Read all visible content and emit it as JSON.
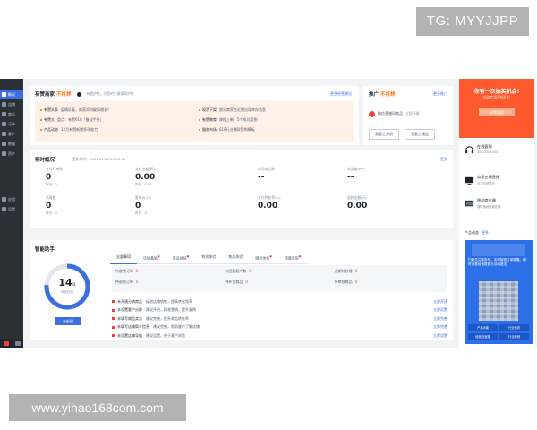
{
  "watermarks": {
    "top": "TG: MYYJJPP",
    "bottom": "www.yihao168com.com"
  },
  "nav": {
    "items": [
      "概况",
      "店铺",
      "商品",
      "订单",
      "客户",
      "数据",
      "资产"
    ],
    "lower_items": [
      "应用",
      "设置"
    ]
  },
  "notice": {
    "title": "有赞商家",
    "title_em": "不打烊",
    "tag": "有赞护航，为您的生意保驾护航",
    "link": "更多经营建议",
    "lines": [
      {
        "k": "有赞头条",
        "v": "疫情反复，商家如何破局增长？"
      },
      {
        "k": "现货下架",
        "v": "部分商家在近期出现库存告急"
      },
      {
        "k": "有赞大",
        "v": "盘点：有赞618「备战手册」"
      },
      {
        "k": "有赞教育",
        "v": "课程上新：5个成功案例"
      },
      {
        "k": "产品动态",
        "v": "12月有赞新增多项能力"
      },
      {
        "k": "服务市场",
        "v": "618行业爆款营销模板"
      }
    ]
  },
  "promo": {
    "title": "推广",
    "title_em": "不打烊",
    "link": "更多推广",
    "row_name": "微信直播间商品",
    "row_state": "立即开通",
    "btn1": "我要上分销",
    "btn2": "我要上爆品"
  },
  "realtime": {
    "title": "实时概况",
    "updated": "更新时间：2021-01-24 23:59:49",
    "link": "更多",
    "stats": [
      {
        "lbl": "支付订单数",
        "val": "0",
        "sub": "昨日：0"
      },
      {
        "lbl": "支付金额(元)",
        "val": "0.00",
        "sub": "昨日：0.00"
      },
      {
        "lbl": "访问商品数",
        "val": "--",
        "sub": ""
      },
      {
        "lbl": "浏览量(PV)",
        "val": "--",
        "sub": ""
      },
      {
        "lbl": "访客数",
        "val": "0",
        "sub": "昨日：0"
      },
      {
        "lbl": "客单价(元)",
        "val": "0",
        "sub": "昨日：0"
      },
      {
        "lbl": "支付转化率(%)",
        "val": "0.00",
        "sub": ""
      },
      {
        "lbl": "退款金额(元)",
        "val": "0.00",
        "sub": ""
      }
    ]
  },
  "assistant": {
    "title": "智能助手",
    "count": "14",
    "count_unit": "项",
    "caption": "待优化项",
    "button": "去处理",
    "tabs": [
      "全部事项",
      "店铺基础",
      "商品体验",
      "物流体验",
      "售后体验",
      "服务体验",
      "流量获取"
    ],
    "tasks": [
      {
        "label": "待发货订单",
        "n": "0"
      },
      {
        "label": "待回复客户数",
        "n": "0"
      },
      {
        "label": "近期待处理",
        "n": "0"
      },
      {
        "label": "待退款订单",
        "n": "0"
      },
      {
        "label": "待补货商品",
        "n": "0"
      },
      {
        "label": "待审核商品",
        "n": "0"
      }
    ],
    "tips": [
      {
        "name": "未开通分销商品",
        "desc": "促进店铺销售，提高转化效率",
        "act": "立即开通"
      },
      {
        "name": "未设置客户分群",
        "desc": "建议开启，精准营销，提升复购",
        "act": "立即设置"
      },
      {
        "name": "未填写商品卖点",
        "desc": "建议完善，提升商品转化率",
        "act": "立即完善"
      },
      {
        "name": "未填写店铺简介信息",
        "desc": "建议完善，帮助客户了解店铺",
        "act": "立即完善"
      },
      {
        "name": "未设置店铺导航",
        "desc": "建议设置，便于客户浏览",
        "act": "立即设置"
      }
    ]
  },
  "ad": {
    "title": "你有一次抽奖机会!",
    "sub": "领取专属营销礼包",
    "btn": "立即领取"
  },
  "side": [
    {
      "t": "在线客服",
      "s": "400-0000-000"
    },
    {
      "t": "商家在线直播",
      "s": "学习经营知识"
    },
    {
      "t": "移动商户端",
      "s": "随时随地管理店铺"
    }
  ],
  "qr": {
    "head": "产品动态",
    "link": "更多",
    "text": "扫码关注服务号，实时接收订单提醒，随时查看经营数据与活动推送",
    "btns": [
      "产品功能",
      "行业资讯",
      "经营百宝箱",
      "行业案例"
    ]
  },
  "colors": {
    "nav_bg": "#2b2f36",
    "accent": "#3d6fe0",
    "brand_orange": "#ff5a2d",
    "alert_red": "#e8463c"
  }
}
